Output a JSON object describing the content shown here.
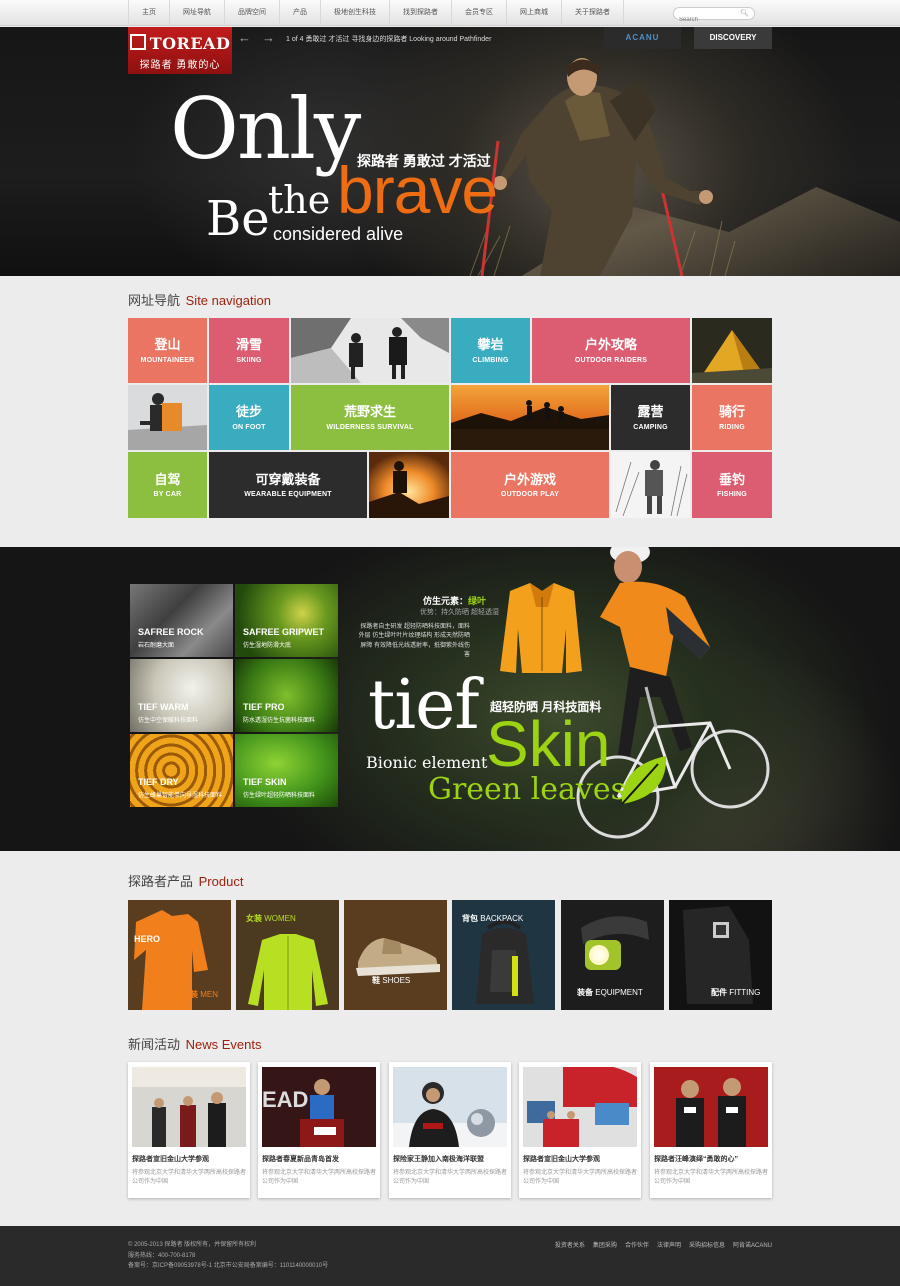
{
  "topnav": {
    "items": [
      "主页",
      "网址导航",
      "品牌空间",
      "产品",
      "极地创生科技",
      "找到探路者",
      "会员专区",
      "网上商城",
      "关于探路者"
    ],
    "search_placeholder": "Search"
  },
  "hero": {
    "logo_brand": "TOREAD",
    "logo_slogan": "探路者 勇敢的心",
    "slide_caption": "1 of 4    勇敢过 才活过 寻找身边的探路者    Looking around Pathfinder",
    "tab_acanu": "ACANU",
    "tab_discovery": "DISCOVERY",
    "headline_only": "Only",
    "headline_cn": "探路者 勇敢过 才活过",
    "headline_be": "Be",
    "headline_the": "the",
    "headline_brave": "brave",
    "headline_considered": "considered alive"
  },
  "site_nav": {
    "title_cn": "网址导航",
    "title_en": "Site navigation",
    "tiles": [
      {
        "cn": "登山",
        "en": "MOUNTAINEER"
      },
      {
        "cn": "滑雪",
        "en": "SKIING"
      },
      {
        "cn": "攀岩",
        "en": "CLIMBING"
      },
      {
        "cn": "户外攻略",
        "en": "OUTDOOR RAIDERS"
      },
      {
        "cn": "徒步",
        "en": "ON FOOT"
      },
      {
        "cn": "荒野求生",
        "en": "WILDERNESS SURVIVAL"
      },
      {
        "cn": "露营",
        "en": "CAMPING"
      },
      {
        "cn": "骑行",
        "en": "RIDING"
      },
      {
        "cn": "自驾",
        "en": "BY CAR"
      },
      {
        "cn": "可穿戴装备",
        "en": "WEARABLE EQUIPMENT"
      },
      {
        "cn": "户外游戏",
        "en": "OUTDOOR PLAY"
      },
      {
        "cn": "垂钓",
        "en": "FISHING"
      }
    ],
    "colors": {
      "salmon": "#ea7562",
      "teal": "#3aacbf",
      "pink": "#dc5d71",
      "green": "#8cbf3f",
      "dark": "#2c2c2c"
    }
  },
  "tief": {
    "materials": [
      {
        "name": "SAFREE ROCK",
        "desc": "岩石耐磨大面"
      },
      {
        "name": "SAFREE GRIPWET",
        "desc": "仿生湿地防滑大底"
      },
      {
        "name": "TIEF WARM",
        "desc": "仿生中空保暖科技面料"
      },
      {
        "name": "TIEF PRO",
        "desc": "防水透湿仿生抗菌科技面料"
      },
      {
        "name": "TIEF DRY",
        "desc": "仿生蜂巢智能单向导湿科技面料"
      },
      {
        "name": "TIEF SKIN",
        "desc": "仿生绿叶超轻防晒科技面料"
      }
    ],
    "element_label": "仿生元素：",
    "element_value": "绿叶",
    "advantage": "优势：持久防晒 超轻透湿",
    "description": "探路者自主研发 超轻防晒科技面料，面料外层 仿生绿叶叶片纹理结构 形成天然防晒屏障 有效降低光线透射率，抵御紫外线伤害",
    "word_tief": "tief",
    "word_bionic": "Bionic element",
    "cn_label": "超轻防晒 月科技面料",
    "word_skin": "Skin",
    "word_green": "Green leaves"
  },
  "product": {
    "title_cn": "探路者产品",
    "title_en": "Product",
    "items": [
      {
        "cn": "男装",
        "en": "MEN"
      },
      {
        "cn": "女装",
        "en": "WOMEN"
      },
      {
        "cn": "鞋",
        "en": "SHOES"
      },
      {
        "cn": "背包",
        "en": "BACKPACK"
      },
      {
        "cn": "装备",
        "en": "EQUIPMENT"
      },
      {
        "cn": "配件",
        "en": "FITTING"
      }
    ]
  },
  "news": {
    "title_cn": "新闻活动",
    "title_en": "News Events",
    "items": [
      {
        "title": "探路者宣旧金山大学参观",
        "summary": "将参观北京大学和清华大学两所高校探路者公司作为中国"
      },
      {
        "title": "探路者春夏新品青岛首发",
        "summary": "将参观北京大学和清华大学两所高校探路者公司作为中国"
      },
      {
        "title": "探险家王静加入南极海洋联盟",
        "summary": "将参观北京大学和清华大学两所高校探路者公司作为中国"
      },
      {
        "title": "探路者宣旧金山大学参观",
        "summary": "将参观北京大学和清华大学两所高校探路者公司作为中国"
      },
      {
        "title": "探路者汪峰演绎“勇敢的心”",
        "summary": "将参观北京大学和清华大学两所高校探路者公司作为中国"
      }
    ]
  },
  "footer": {
    "copyright": "© 2005-2013 探路者 版权所有，并保留所有权利",
    "hotline": "服务热线：400-700-8178",
    "record": "备案号：京ICP备09053978号-1 北京市公安局备案编号：1101140000010号",
    "links": [
      "投资者关系",
      "集团采购",
      "合作伙伴",
      "法律声明",
      "采购招标信息",
      "阿肯诺ACANU"
    ]
  }
}
